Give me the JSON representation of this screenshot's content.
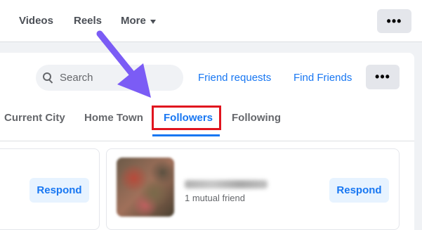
{
  "topnav": {
    "items": [
      "Videos",
      "Reels"
    ],
    "more_label": "More",
    "menu_glyph": "•••"
  },
  "friends_header": {
    "search_placeholder": "Search",
    "friend_requests": "Friend requests",
    "find_friends": "Find Friends",
    "menu_glyph": "•••"
  },
  "tabs": [
    "Current City",
    "Home Town",
    "Followers",
    "Following"
  ],
  "active_tab": "Followers",
  "cards": [
    {
      "respond_label": "Respond"
    },
    {
      "mutual": "1 mutual friend",
      "respond_label": "Respond"
    }
  ],
  "colors": {
    "accent": "#1877f2",
    "highlight": "#e0141e",
    "arrow": "#7b5cf5"
  }
}
